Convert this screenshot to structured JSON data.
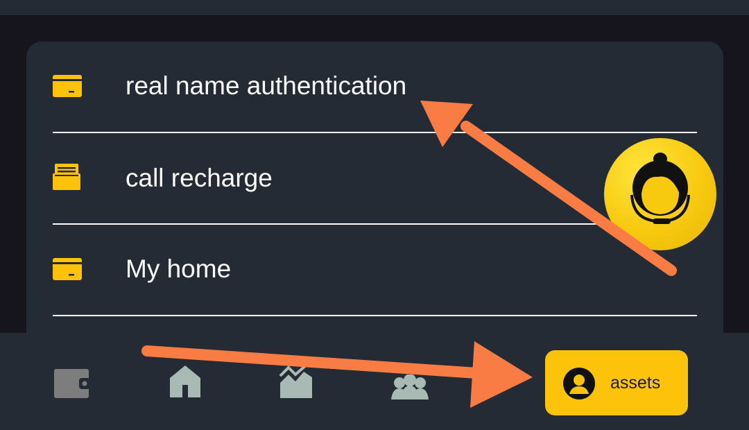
{
  "menu": {
    "items": [
      {
        "label": "real name authentication",
        "icon": "card-icon"
      },
      {
        "label": "call recharge",
        "icon": "receipt-icon"
      },
      {
        "label": "My home",
        "icon": "card-icon"
      }
    ]
  },
  "support": {
    "icon": "customer-service-icon"
  },
  "bottom_nav": {
    "items": [
      {
        "icon": "wallet-icon",
        "active": false
      },
      {
        "icon": "home-icon",
        "active": false
      },
      {
        "icon": "chart-icon",
        "active": false
      },
      {
        "icon": "team-icon",
        "active": false
      },
      {
        "icon": "user-avatar-icon",
        "label": "assets",
        "active": true
      }
    ]
  },
  "annotations": {
    "arrow_color": "#fa7c45"
  },
  "colors": {
    "background": "#16151d",
    "card": "#252b35",
    "accent": "#fdc30a",
    "inactive_icon": "#a9bab4"
  }
}
